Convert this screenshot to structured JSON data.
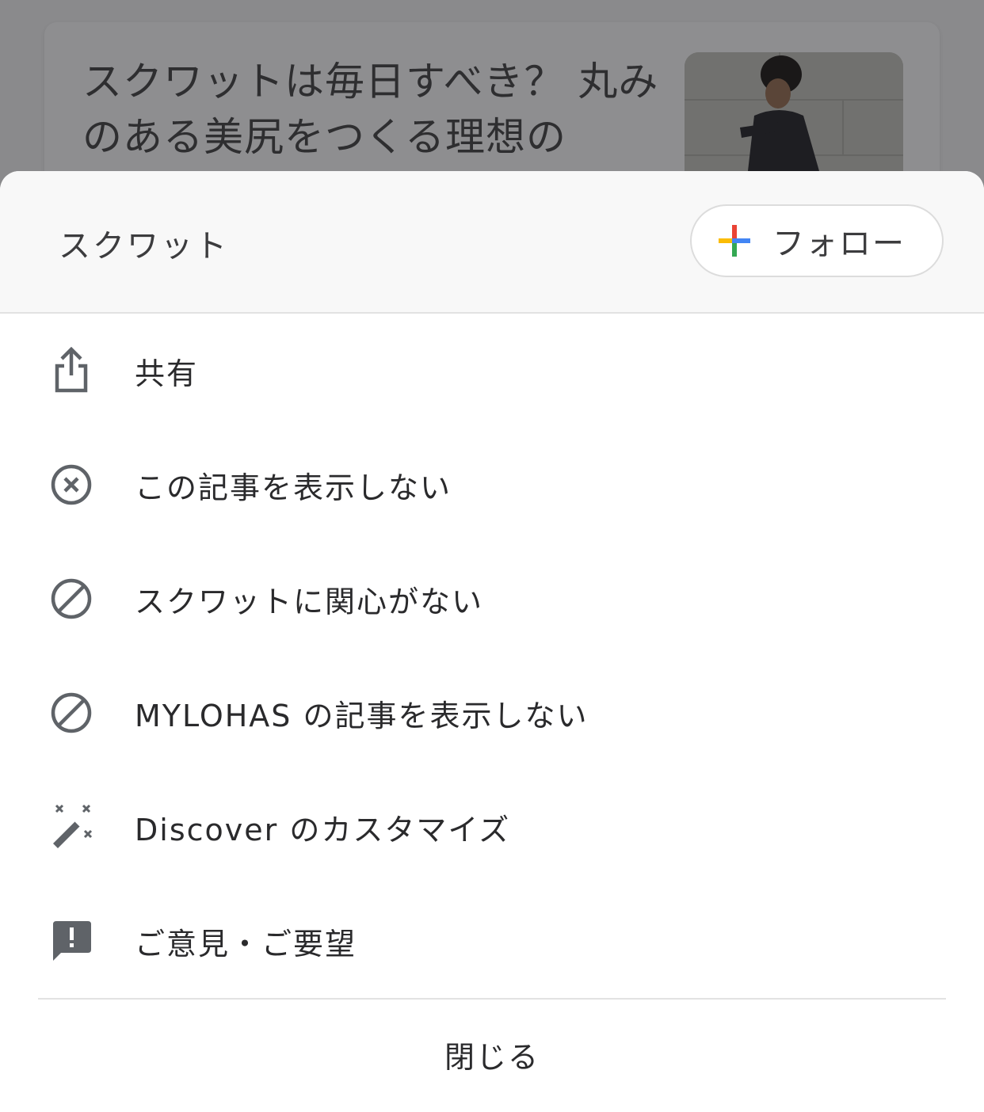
{
  "background_article": {
    "title": "スクワットは毎日すべき？ 丸みのある美尻をつくる理想の"
  },
  "sheet": {
    "topic": "スクワット",
    "follow_label": "フォロー",
    "items": [
      {
        "label": "共有",
        "icon": "share-icon"
      },
      {
        "label": "この記事を表示しない",
        "icon": "close-circle-icon"
      },
      {
        "label": "スクワットに関心がない",
        "icon": "block-icon"
      },
      {
        "label": "MYLOHAS の記事を表示しない",
        "icon": "block-icon"
      },
      {
        "label": "Discover のカスタマイズ",
        "icon": "magic-wand-icon"
      },
      {
        "label": "ご意見・ご要望",
        "icon": "feedback-icon"
      }
    ],
    "close_label": "閉じる"
  },
  "colors": {
    "icon_gray": "#5f6368",
    "google_blue": "#4285F4",
    "google_red": "#EA4335",
    "google_yellow": "#FBBC05",
    "google_green": "#34A853"
  }
}
